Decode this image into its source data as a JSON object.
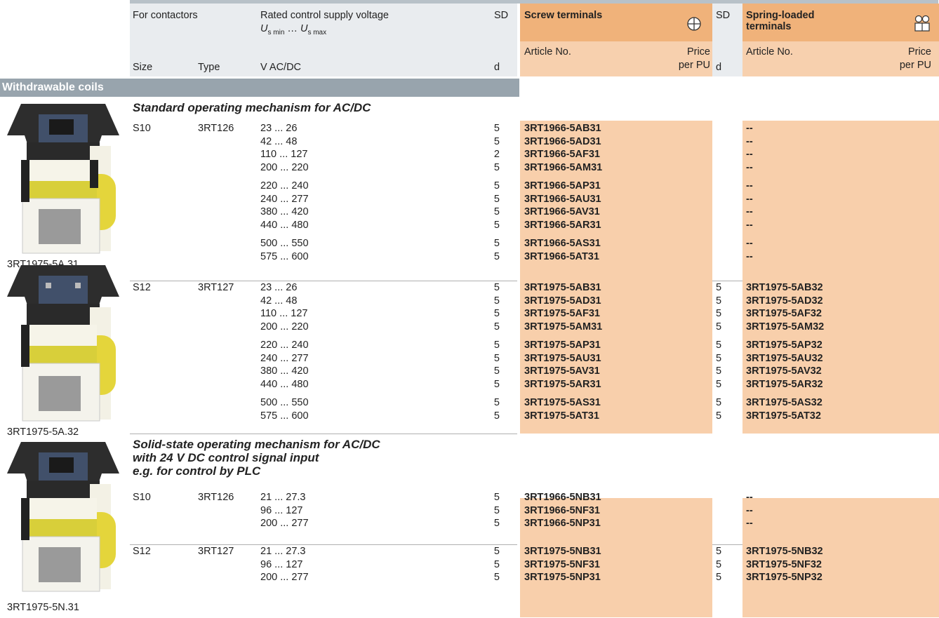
{
  "header": {
    "for_contactors": "For contactors",
    "rated_voltage": "Rated control supply voltage",
    "us_label_u": "U",
    "us_min_sub": "s min",
    "us_dots": " … ",
    "us_max_sub": "s max",
    "sd": "SD",
    "screw_terminals": "Screw terminals",
    "spring_loaded_1": "Spring-loaded",
    "spring_loaded_2": "terminals",
    "article_no": "Article No.",
    "price_1": "Price",
    "price_2": "per PU",
    "size": "Size",
    "type": "Type",
    "unit": "V AC/DC",
    "d": "d"
  },
  "section_title": "Withdrawable coils",
  "groups": [
    {
      "heading": [
        "Standard operating mechanism for AC/DC"
      ],
      "image_caption": "3RT1975-5A.31",
      "size": "S10",
      "type": "3RT126",
      "rows": [
        {
          "v": "23 ... 26",
          "sd": "5",
          "screw": "3RT1966-5AB31",
          "sd2": "",
          "spring": "--"
        },
        {
          "v": "42 ... 48",
          "sd": "5",
          "screw": "3RT1966-5AD31",
          "sd2": "",
          "spring": "--"
        },
        {
          "v": "110 ... 127",
          "sd": "2",
          "screw": "3RT1966-5AF31",
          "sd2": "",
          "spring": "--"
        },
        {
          "v": "200 ... 220",
          "sd": "5",
          "screw": "3RT1966-5AM31",
          "sd2": "",
          "spring": "--"
        },
        {
          "v": "220 ... 240",
          "sd": "5",
          "screw": "3RT1966-5AP31",
          "sd2": "",
          "spring": "--"
        },
        {
          "v": "240 ... 277",
          "sd": "5",
          "screw": "3RT1966-5AU31",
          "sd2": "",
          "spring": "--"
        },
        {
          "v": "380 ... 420",
          "sd": "5",
          "screw": "3RT1966-5AV31",
          "sd2": "",
          "spring": "--"
        },
        {
          "v": "440 ... 480",
          "sd": "5",
          "screw": "3RT1966-5AR31",
          "sd2": "",
          "spring": "--"
        },
        {
          "v": "500 ... 550",
          "sd": "5",
          "screw": "3RT1966-5AS31",
          "sd2": "",
          "spring": "--"
        },
        {
          "v": "575 ... 600",
          "sd": "5",
          "screw": "3RT1966-5AT31",
          "sd2": "",
          "spring": "--"
        }
      ]
    },
    {
      "image_caption": "3RT1975-5A.32",
      "size": "S12",
      "type": "3RT127",
      "rows": [
        {
          "v": "23 ... 26",
          "sd": "5",
          "screw": "3RT1975-5AB31",
          "sd2": "5",
          "spring": "3RT1975-5AB32"
        },
        {
          "v": "42 ... 48",
          "sd": "5",
          "screw": "3RT1975-5AD31",
          "sd2": "5",
          "spring": "3RT1975-5AD32"
        },
        {
          "v": "110 ... 127",
          "sd": "5",
          "screw": "3RT1975-5AF31",
          "sd2": "5",
          "spring": "3RT1975-5AF32"
        },
        {
          "v": "200 ... 220",
          "sd": "5",
          "screw": "3RT1975-5AM31",
          "sd2": "5",
          "spring": "3RT1975-5AM32"
        },
        {
          "v": "220 ... 240",
          "sd": "5",
          "screw": "3RT1975-5AP31",
          "sd2": "5",
          "spring": "3RT1975-5AP32"
        },
        {
          "v": "240 ... 277",
          "sd": "5",
          "screw": "3RT1975-5AU31",
          "sd2": "5",
          "spring": "3RT1975-5AU32"
        },
        {
          "v": "380 ... 420",
          "sd": "5",
          "screw": "3RT1975-5AV31",
          "sd2": "5",
          "spring": "3RT1975-5AV32"
        },
        {
          "v": "440 ... 480",
          "sd": "5",
          "screw": "3RT1975-5AR31",
          "sd2": "5",
          "spring": "3RT1975-5AR32"
        },
        {
          "v": "500 ... 550",
          "sd": "5",
          "screw": "3RT1975-5AS31",
          "sd2": "5",
          "spring": "3RT1975-5AS32"
        },
        {
          "v": "575 ... 600",
          "sd": "5",
          "screw": "3RT1975-5AT31",
          "sd2": "5",
          "spring": "3RT1975-5AT32"
        }
      ]
    },
    {
      "heading": [
        "Solid-state operating mechanism for AC/DC",
        "with 24 V DC control signal input",
        "e.g. for control by PLC"
      ],
      "image_caption": "3RT1975-5N.31",
      "size": "S10",
      "type": "3RT126",
      "rows": [
        {
          "v": "21 ... 27.3",
          "sd": "5",
          "screw": "3RT1966-5NB31",
          "sd2": "",
          "spring": "--"
        },
        {
          "v": "96 ... 127",
          "sd": "5",
          "screw": "3RT1966-5NF31",
          "sd2": "",
          "spring": "--"
        },
        {
          "v": "200 ... 277",
          "sd": "5",
          "screw": "3RT1966-5NP31",
          "sd2": "",
          "spring": "--"
        }
      ]
    },
    {
      "size": "S12",
      "type": "3RT127",
      "rows": [
        {
          "v": "21 ... 27.3",
          "sd": "5",
          "screw": "3RT1975-5NB31",
          "sd2": "5",
          "spring": "3RT1975-5NB32"
        },
        {
          "v": "96 ... 127",
          "sd": "5",
          "screw": "3RT1975-5NF31",
          "sd2": "5",
          "spring": "3RT1975-5NF32"
        },
        {
          "v": "200 ... 277",
          "sd": "5",
          "screw": "3RT1975-5NP31",
          "sd2": "5",
          "spring": "3RT1975-5NP32"
        }
      ]
    }
  ],
  "icons": {
    "screw": "screw-terminal-icon",
    "spring": "spring-terminal-icon",
    "product": "withdrawable-coil-image"
  },
  "colors": {
    "header_orange": "#f0b27a",
    "column_fill": "#f8cfab",
    "section_band": "#98a4ad",
    "header_gray": "#e9ecef"
  }
}
